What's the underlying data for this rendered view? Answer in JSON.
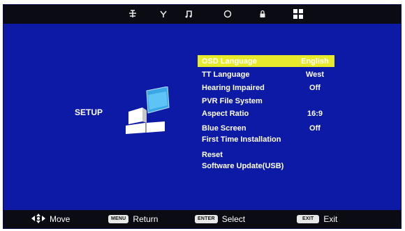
{
  "header": {
    "tabs": [
      {
        "icon": "tv-channel-icon"
      },
      {
        "icon": "antenna-icon"
      },
      {
        "icon": "music-note-icon"
      },
      {
        "icon": "clock-icon"
      },
      {
        "icon": "lock-icon"
      },
      {
        "icon": "setup-grid-icon",
        "active": true
      }
    ]
  },
  "page": {
    "title": "SETUP"
  },
  "menu": {
    "items": [
      {
        "label": "OSD Language",
        "value": "English",
        "selected": true
      },
      {
        "label": "TT Language",
        "value": "West"
      },
      {
        "label": "Hearing Impaired",
        "value": "Off"
      },
      {
        "label": "PVR File System",
        "value": ""
      },
      {
        "label": "Aspect Ratio",
        "value": "16:9"
      },
      {
        "label": "Blue Screen",
        "value": "Off"
      },
      {
        "label": "First Time Installation",
        "value": ""
      },
      {
        "label": "Reset",
        "value": ""
      },
      {
        "label": "Software Update(USB)",
        "value": ""
      }
    ]
  },
  "footer": {
    "move": {
      "label": "Move"
    },
    "return": {
      "key": "MENU",
      "label": "Return"
    },
    "select": {
      "key": "ENTER",
      "label": "Select"
    },
    "exit": {
      "key": "EXIT",
      "label": "Exit"
    }
  },
  "colors": {
    "background": "#0d1aa6",
    "bars": "#0b0b14",
    "highlight": "#e6ea2a",
    "graphic_blue": "#3aa8e8"
  }
}
